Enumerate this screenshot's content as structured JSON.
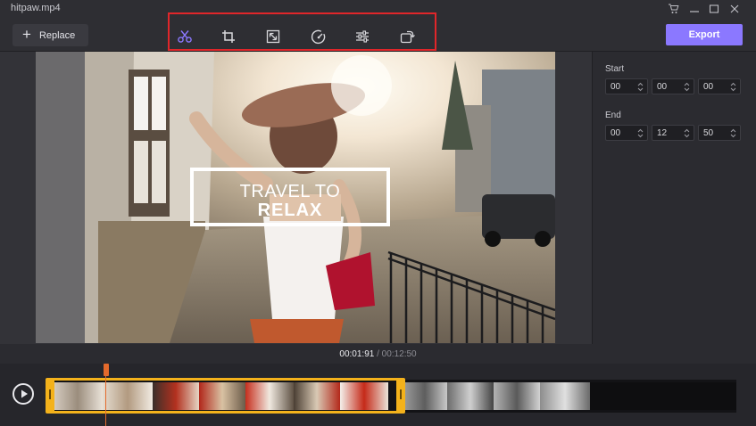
{
  "window": {
    "title": "hitpaw.mp4",
    "controls": [
      "cart-icon",
      "minimize-icon",
      "maximize-icon",
      "close-icon"
    ]
  },
  "toolbar": {
    "replace_label": "Replace",
    "export_label": "Export",
    "tools": [
      {
        "name": "cut",
        "icon": "scissors-icon",
        "active": true
      },
      {
        "name": "crop",
        "icon": "crop-icon"
      },
      {
        "name": "resize",
        "icon": "resize-icon"
      },
      {
        "name": "speed",
        "icon": "speed-icon"
      },
      {
        "name": "adjust",
        "icon": "sliders-icon"
      },
      {
        "name": "rotate",
        "icon": "rotate-icon"
      }
    ],
    "highlight_color": "#e0262a",
    "accent": "#8b78ff"
  },
  "preview": {
    "overlay_line1": "TRAVEL TO",
    "overlay_line2": "RELAX"
  },
  "trim": {
    "start_label": "Start",
    "end_label": "End",
    "start": [
      "00",
      "00",
      "00"
    ],
    "end": [
      "00",
      "12",
      "50"
    ]
  },
  "timeline": {
    "current_time": "00:01:91",
    "separator": " / ",
    "total_time": "00:12:50",
    "selection_color": "#f4b21b",
    "playhead_color": "#e46a2c"
  }
}
